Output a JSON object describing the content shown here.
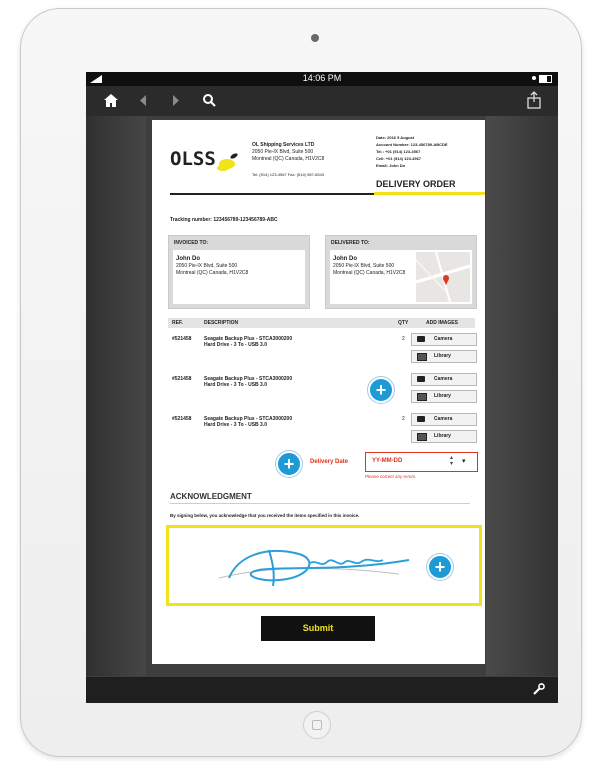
{
  "status_bar": {
    "time": "14:06 PM"
  },
  "company": {
    "logo_text": "OLSS",
    "name": "OL Shipping Services LTD",
    "address1": "2050 Pie-IX Blvd, Suite 500",
    "address2": "Montreal (QC) Canada, H1V2C8",
    "phone_fax": "Tel: (514) 123-4567 Fax: (514) 987-6543"
  },
  "meta": {
    "line1": "Date: 2016 5 August",
    "line2": "Account Number: 123-456789-ABCDE",
    "line3": "Tel.: +01 (514) 123-4567",
    "line4": "Cell: +01 (514) 123-4567",
    "line5": "Email: John Do"
  },
  "doc_title": "DELIVERY ORDER",
  "tracking": "Tracking number: 123456789-123456789-ABC",
  "invoiced": {
    "header": "INVOICED TO:",
    "name": "John Do",
    "addr1": "2050 Pie-IX Blvd, Suite 500",
    "addr2": "Montreal (QC) Canada, H1V2C8"
  },
  "delivered": {
    "header": "DELIVERED TO:",
    "name": "John Do",
    "addr1": "2050 Pie-IX Blvd, Suite 500",
    "addr2": "Montreal (QC) Canada, H1V2C8"
  },
  "table": {
    "headers": {
      "ref": "REF.",
      "desc": "DESCRIPTION",
      "qty": "QTY",
      "images": "ADD IMAGES"
    },
    "rows": [
      {
        "ref": "#521458",
        "desc1": "Seagate Backup Plus - STCA3000200",
        "desc2": "Hard Drive - 3 To - USB 3.0",
        "qty": "2"
      },
      {
        "ref": "#521458",
        "desc1": "Seagate Backup Plus - STCA3000200",
        "desc2": "Hard Drive - 3 To - USB 3.0",
        "qty": ""
      },
      {
        "ref": "#521458",
        "desc1": "Seagate Backup Plus - STCA3000200",
        "desc2": "Hard Drive - 3 To - USB 3.0",
        "qty": "2"
      }
    ],
    "camera_label": "Camera",
    "library_label": "Library"
  },
  "delivery_date": {
    "label": "Delivery Date",
    "placeholder": "YY-MM-DD",
    "error": "Please correct any errors."
  },
  "ack": {
    "title": "ACKNOWLEDGMENT",
    "text": "By signing below, you acknowledge that you received the items specified in this invoice."
  },
  "submit_label": "Submit",
  "colors": {
    "accent_yellow": "#f2e21a",
    "accent_blue": "#1e9ad6",
    "error_red": "#e0301e",
    "dark_bar": "#2b2b2b"
  }
}
